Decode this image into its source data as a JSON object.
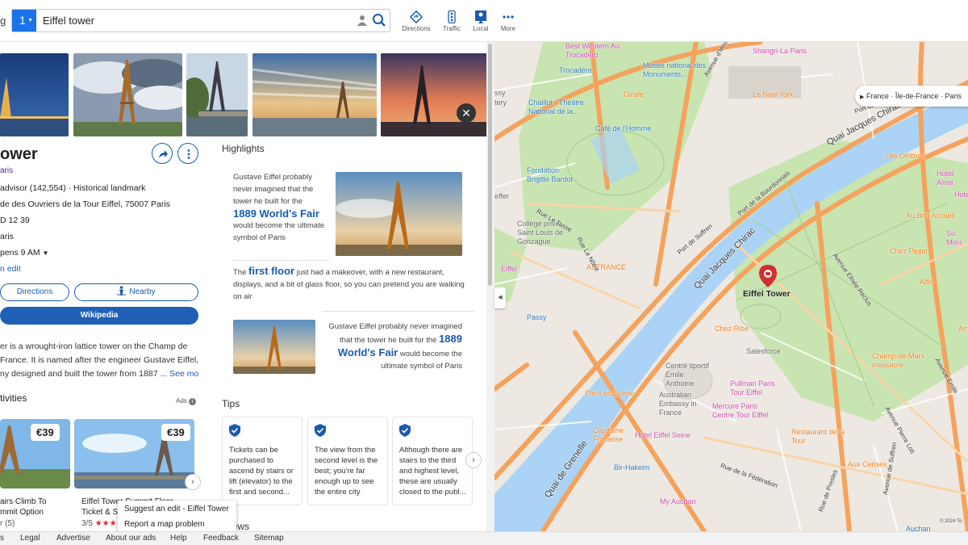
{
  "topbar": {
    "cut_text": "g",
    "search_number": "1",
    "search_value": "Eiffel tower",
    "tools": [
      {
        "label": "Directions",
        "icon": "directions-icon"
      },
      {
        "label": "Traffic",
        "icon": "traffic-light-icon"
      },
      {
        "label": "Local",
        "icon": "local-icon"
      },
      {
        "label": "More",
        "icon": "more-dots-icon"
      }
    ]
  },
  "place": {
    "title": "ower",
    "subtype": "aris",
    "rating_line": "advisor (142,554) · Historical landmark",
    "address": "de des Ouvriers de la Tour Eiffel, 75007 Paris",
    "phone": "D 12 39",
    "city": "aris",
    "hours": "pens 9 AM",
    "edit_link": "n edit",
    "directions_label": "Directions",
    "nearby_label": "Nearby",
    "wikipedia_label": "Wikipedia",
    "description": [
      "er is a wrought-iron lattice tower on the Champ de",
      "France. It is named after the engineer Gustave Eiffel,",
      "ny designed and built the tower from 1887 ..."
    ],
    "see_more": "See more"
  },
  "activities": {
    "title": "tivities",
    "ads_label": "Ads",
    "cards": [
      {
        "price": "€39",
        "name_line1": "airs Climb To",
        "name_line2": "mmit Option",
        "rating": "r (5)"
      },
      {
        "price": "€39",
        "name_line1": "Eiffel Tower Summit Floor",
        "name_line2": "Ticket & S",
        "rating": "3/5"
      }
    ]
  },
  "highlights": {
    "title": "Highlights",
    "item1": {
      "lines": [
        "Gustave Eiffel probably",
        "never imagined that the",
        "tower he built for the"
      ],
      "big": "1889 World's Fair",
      "after": [
        "would become the ultimate",
        "symbol of Paris"
      ]
    },
    "item2": {
      "pre": "The ",
      "big": "first floor",
      "post": " just had a makeover, with a new restaurant,",
      "lines": [
        "displays, and a bit of glass floor, so you can pretend you are walking",
        "on air"
      ]
    },
    "item3": {
      "line1": "Gustave Eiffel probably never imagined",
      "line2_pre": "that the tower he built for the ",
      "big1": "1889",
      "big2": "World's Fair",
      "line3_post": " would become the",
      "line4": "ultimate symbol of Paris"
    }
  },
  "tips": {
    "title": "Tips",
    "items": [
      "Tickets can be purchased to ascend by stairs or lift (elevator) to the first and second...",
      "The view from the second level is the best; you're far enough up to see the entire city",
      "Although there are stairs to the third and highest level, these are usually closed to the publ..."
    ]
  },
  "reviews": {
    "title": "iews"
  },
  "popup": {
    "suggest": "Suggest an edit - Eiffel Tower",
    "report": "Report a map problem"
  },
  "map": {
    "breadcrumb": "France · Île-de-France · Paris",
    "copyright": "© 2024 To",
    "marker_label": "Eiffel Tower",
    "pois": [
      "Best Western Au Trocadéro",
      "Trocadéro",
      "Musée national des Monuments...",
      "Shangri-La Paris",
      "Girafe",
      "Le New York",
      "Chaillot - Théâtre National de la...",
      "Café de l'Homme",
      "Fondation Brigitte Bardot",
      "Les Ombres",
      "Hotel Alma",
      "Hotel",
      "Au Bon Accueil",
      "Su Misu",
      "Chez Pippo",
      "Alfio",
      "ASTRANCE",
      "Collège privé Saint Louis de Gonzague",
      "Passy",
      "Chez Ribe",
      "Salesforce",
      "Centre sportif Emile Anthoine",
      "Champ-de-Mars massacre",
      "Pullman Paris Tour Eiffel",
      "Paris en Scène",
      "Australian Embassy in France",
      "Mercure Paris Centre Tour Eiffel",
      "Restaurant de la Tour",
      "Capitaine Fracasse",
      "Hotel Eiffel Seine",
      "Bir-Hakeim",
      "Aux Cerises",
      "My Auchan",
      "Auchan",
      "Arna",
      "Eiffel",
      "ssy",
      "tery",
      "effer"
    ],
    "streets": [
      "Avenue d'Iéna",
      "Port de la...",
      "Quai Jacques Chirac",
      "Quai Jacques Chirac",
      "Rue Le Tasse",
      "Rue Le Nôtre",
      "Port de Suffren",
      "Port de la Bourdonnais",
      "Avenue Elisée Reclus",
      "Avenue Emile",
      "Avenue Pierre Loti",
      "Avenue de Suffren",
      "Rue de la Fédération",
      "Quai de Grenelle",
      "Rue de Presles"
    ]
  },
  "footer": {
    "items": [
      "s",
      "Legal",
      "Advertise",
      "About our ads",
      "Help",
      "Feedback",
      "Sitemap"
    ]
  },
  "colors": {
    "accent": "#1a73e8",
    "link": "#1a5bb0",
    "marker": "#d32f2f",
    "water": "#aad3f5",
    "park": "#c8e4b0",
    "road_major": "#f5a25d",
    "poi_orange": "#ef7d1a",
    "poi_pink": "#d14bb0"
  }
}
